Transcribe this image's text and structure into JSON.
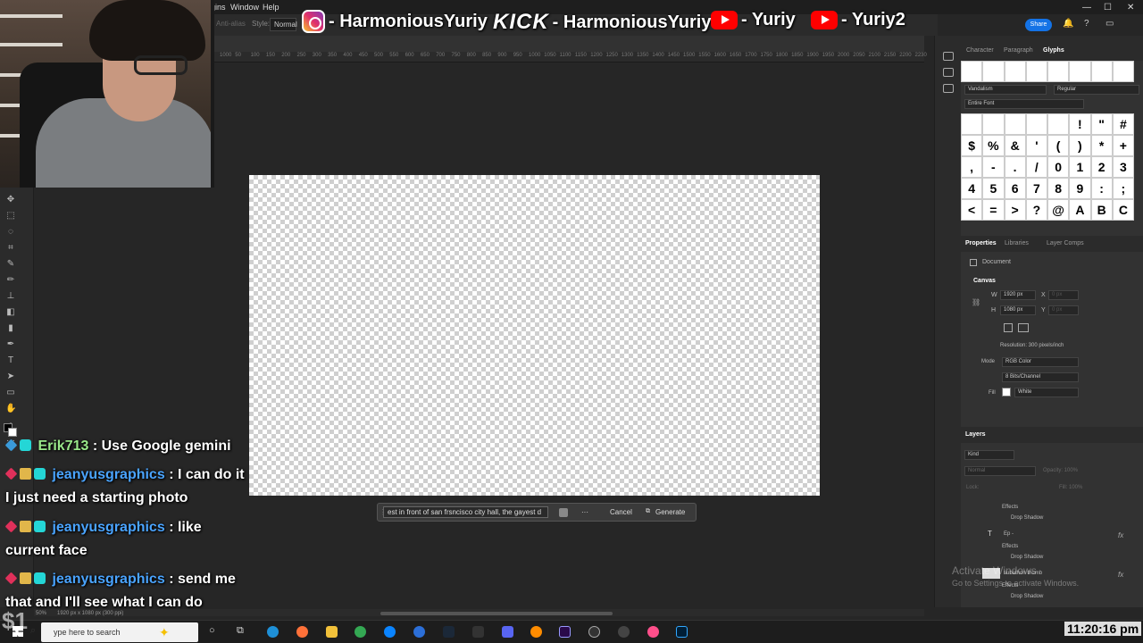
{
  "menu": {
    "plugins": "gins",
    "window": "Window",
    "help": "Help",
    "style_label": "Style:",
    "style_value": "Normal",
    "anti_alias": "Anti-alias"
  },
  "window_controls": {
    "minimize": "—",
    "maximize": "☐",
    "close": "✕"
  },
  "share_label": "Share",
  "social": {
    "instagram": "- HarmoniousYuriy",
    "kick_logo": "KICK",
    "kick": "- HarmoniousYuriy",
    "youtube1": "- Yuriy",
    "youtube2": "- Yuriy2"
  },
  "ruler_ticks": [
    "1000",
    "50",
    "100",
    "150",
    "200",
    "250",
    "300",
    "350",
    "400",
    "450",
    "500",
    "550",
    "600",
    "650",
    "700",
    "750",
    "800",
    "850",
    "900",
    "950",
    "1000",
    "1050",
    "1100",
    "1150",
    "1200",
    "1250",
    "1300",
    "1350",
    "1400",
    "1450",
    "1500",
    "1550",
    "1600",
    "1650",
    "1700",
    "1750",
    "1800",
    "1850",
    "1900",
    "1950",
    "2000",
    "2050",
    "2100",
    "2150",
    "2200",
    "2230"
  ],
  "generate_bar": {
    "prompt": "est in front of san frsncisco city hall, the gayest d",
    "more": "···",
    "cancel": "Cancel",
    "generate": "Generate"
  },
  "chat": [
    {
      "user": "Erik713",
      "message": ": Use Google gemini"
    },
    {
      "user": "jeanyusgraphics",
      "message": ": I can do it"
    },
    {
      "continuation": "I just need a starting photo"
    },
    {
      "user": "jeanyusgraphics",
      "message": ": like"
    },
    {
      "continuation": "current face"
    },
    {
      "user": "jeanyusgraphics",
      "message": ": send me"
    },
    {
      "continuation": "that and I'll see what I can do"
    }
  ],
  "char_panel": {
    "tabs": [
      "Character",
      "Paragraph",
      "Glyphs"
    ],
    "font_family": "Vandalism",
    "font_style": "Regular",
    "font_subset": "Entire Font",
    "glyphs": [
      [
        "",
        "",
        "",
        "",
        "",
        "!",
        "\"",
        "#"
      ],
      [
        "$",
        "%",
        "&",
        "'",
        "(",
        ")",
        "*",
        "+"
      ],
      [
        ",",
        "-",
        ".",
        "/",
        "0",
        "1",
        "2",
        "3"
      ],
      [
        "4",
        "5",
        "6",
        "7",
        "8",
        "9",
        ":",
        ";"
      ],
      [
        "<",
        "=",
        ">",
        "?",
        "@",
        "A",
        "B",
        "C"
      ]
    ]
  },
  "properties": {
    "tabs": [
      "Properties",
      "Libraries",
      "Layer Comps"
    ],
    "document": "Document",
    "canvas_title": "Canvas",
    "w_label": "W",
    "width": "1920 px",
    "h_label": "H",
    "height": "1080 px",
    "x_label": "X",
    "y_label": "Y",
    "x_placeholder": "0 px",
    "y_placeholder": "0 px",
    "resolution": "Resolution: 300 pixels/inch",
    "mode_label": "Mode",
    "mode": "RGB Color",
    "bits": "8 Bits/Channel",
    "fill_label": "Fill",
    "fill": "White"
  },
  "layers": {
    "title": "Layers",
    "kind": "Kind",
    "blend": "Normal",
    "opacity": "Opacity: 100%",
    "lock": "Lock:",
    "fill": "Fill: 100%",
    "items": [
      {
        "label": "Effects",
        "sub": "Drop Shadow"
      },
      {
        "label": "Ep -",
        "effects": "Effects",
        "sub": "Drop Shadow"
      },
      {
        "label": "subathon thumb",
        "effects": "Effects",
        "sub": "Drop Shadow"
      }
    ]
  },
  "watermark": {
    "line1": "Activate Windows",
    "line2": "Go to Settings to activate Windows."
  },
  "taskbar": {
    "search_placeholder": "ype here to search",
    "clock": "11:20:16 pm"
  },
  "status": {
    "zoom": "50%",
    "doc_size": "1920 px x 1080 px (300 ppi)",
    "bitrate": "$1"
  }
}
